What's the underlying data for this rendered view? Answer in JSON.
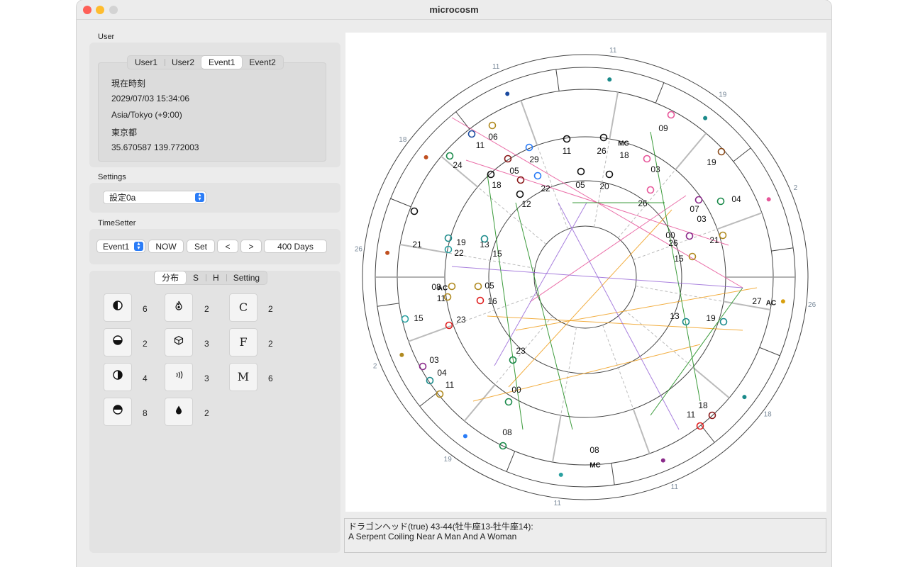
{
  "window": {
    "title": "microcosm"
  },
  "user": {
    "section_label": "User",
    "tabs": [
      "User1",
      "User2",
      "Event1",
      "Event2"
    ],
    "active_tab": 2,
    "info": {
      "name": "現在時刻",
      "datetime": "2029/07/03 15:34:06",
      "timezone": "Asia/Tokyo (+9:00)",
      "place": "東京都",
      "coords": "35.670587 139.772003"
    }
  },
  "settings": {
    "section_label": "Settings",
    "selected": "設定0a"
  },
  "timesetter": {
    "section_label": "TimeSetter",
    "target": "Event1",
    "now_label": "NOW",
    "set_label": "Set",
    "prev_label": "<",
    "next_label": ">",
    "step_label": "400 Days"
  },
  "dist": {
    "tabs": [
      "分布",
      "S",
      "H",
      "Setting"
    ],
    "active_tab": 0,
    "counts": {
      "col1": [
        "6",
        "2",
        "4",
        "8"
      ],
      "col2": [
        "2",
        "3",
        "3",
        "2"
      ],
      "col3": [
        "2",
        "2",
        "6"
      ]
    },
    "letters": [
      "C",
      "F",
      "M"
    ]
  },
  "chart": {
    "outer_numbers": [
      "11",
      "11",
      "18",
      "26",
      "2",
      "19",
      "11",
      "11",
      "18",
      "26",
      "2",
      "19"
    ],
    "angle_labels": [
      "AC",
      "MC"
    ],
    "inner_labels": [
      "06",
      "11",
      "29",
      "11",
      "26",
      "18",
      "09",
      "24",
      "05",
      "03",
      "19",
      "18",
      "22",
      "05",
      "20",
      "26",
      "04",
      "12",
      "07",
      "03",
      "00",
      "26",
      "21",
      "15",
      "21",
      "19",
      "22",
      "13",
      "15",
      "08",
      "05",
      "11",
      "16",
      "27",
      "15",
      "23",
      "13",
      "19",
      "23",
      "03",
      "04",
      "11",
      "00",
      "18",
      "11",
      "08",
      "08"
    ]
  },
  "description": {
    "line1": "ドラゴンヘッド(true) 43-44(牡牛座13-牡牛座14):",
    "line2": "A Serpent Coiling Near A Man And A Woman"
  },
  "colors": {
    "accent": "#2a7cf7",
    "pink": "#e7569a",
    "orange": "#f0a020",
    "green": "#1a8a1a",
    "purple": "#9a6ad8"
  }
}
